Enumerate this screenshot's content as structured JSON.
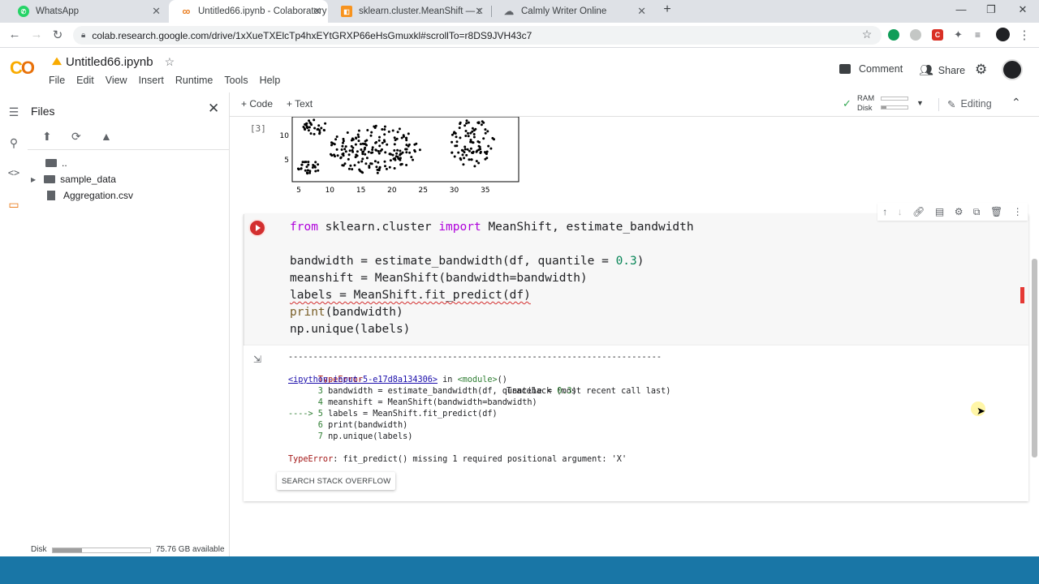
{
  "browser": {
    "tabs": [
      {
        "title": "WhatsApp",
        "favicon": "whatsapp-icon",
        "color": "#25d366"
      },
      {
        "title": "Untitled66.ipynb - Colaboratory",
        "favicon": "colab-icon",
        "color": "#f9ab00",
        "active": true
      },
      {
        "title": "sklearn.cluster.MeanShift — scik",
        "favicon": "sklearn-icon",
        "color": "#f7931e"
      },
      {
        "title": "Calmly Writer Online",
        "favicon": "cloud-icon",
        "color": "#5f6368"
      }
    ],
    "url": "colab.research.google.com/drive/1xXueTXElcTp4hxEYtGRXP66eHsGmuxkl#scrollTo=r8DS9JVH43c7"
  },
  "colab": {
    "notebook_title": "Untitled66.ipynb",
    "menu": [
      "File",
      "Edit",
      "View",
      "Insert",
      "Runtime",
      "Tools",
      "Help"
    ],
    "comment_label": "Comment",
    "share_label": "Share",
    "add_code_label": "+ Code",
    "add_text_label": "+ Text",
    "ram_label": "RAM",
    "disk_label": "Disk",
    "editing_label": "Editing"
  },
  "sidebar": {
    "title": "Files",
    "items": [
      {
        "label": ".."
      },
      {
        "label": "sample_data"
      },
      {
        "label": "Aggregation.csv"
      }
    ],
    "disk_label": "Disk",
    "disk_available": "75.76 GB available",
    "disk_fill": 0.3
  },
  "prev_output": {
    "exec_count": "[3]",
    "yticks": [
      "10",
      "5"
    ],
    "xticks": [
      "5",
      "10",
      "15",
      "20",
      "25",
      "30",
      "35"
    ]
  },
  "cell": {
    "code_lines": [
      "from sklearn.cluster import MeanShift, estimate_bandwidth",
      "",
      "bandwidth = estimate_bandwidth(df, quantile = 0.3)",
      "meanshift = MeanShift(bandwidth=bandwidth)",
      "labels = MeanShift.fit_predict(df)",
      "print(bandwidth)",
      "np.unique(labels)"
    ]
  },
  "output": {
    "dashes": "---------------------------------------------------------------------------",
    "error_type": "TypeError",
    "traceback_header": "Traceback (most recent call last)",
    "input_link": "<ipython-input-5-e17d8a134306>",
    "in_text": " in ",
    "module_text": "<module>",
    "module_paren": "()",
    "lines": [
      "      3 bandwidth = estimate_bandwidth(df, quantile = 0.3)",
      "      4 meanshift = MeanShift(bandwidth=bandwidth)",
      "----> 5 labels = MeanShift.fit_predict(df)",
      "      6 print(bandwidth)",
      "      7 np.unique(labels)"
    ],
    "error_message": "TypeError: fit_predict() missing 1 required positional argument: 'X'",
    "stack_overflow_button": "SEARCH STACK OVERFLOW"
  }
}
